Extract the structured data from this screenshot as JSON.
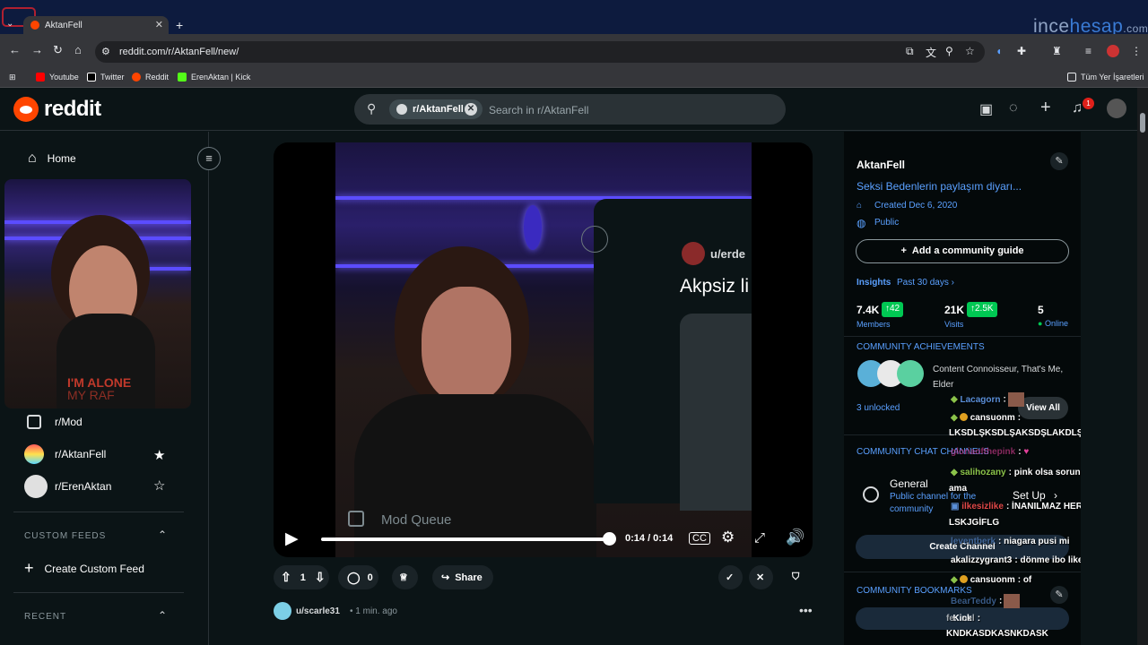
{
  "browser": {
    "tab_title": "AktanFell",
    "url": "reddit.com/r/AktanFell/new/",
    "bookmarks": [
      {
        "label": "Youtube",
        "color": "#ff0000"
      },
      {
        "label": "Twitter",
        "color": "#ffffff"
      },
      {
        "label": "Reddit",
        "color": "#ff4500"
      },
      {
        "label": "ErenAktan | Kick",
        "color": "#53fc18"
      }
    ],
    "bookmarks_folder": "Tüm Yer İşaretleri",
    "watermark_a": "ince",
    "watermark_b": "hesap",
    "watermark_c": ".com"
  },
  "header": {
    "brand": "reddit",
    "search_chip": "r/AktanFell",
    "search_placeholder": "Search in r/AktanFell",
    "notification_count": "1"
  },
  "left": {
    "home": "Home",
    "webcam_caption_1": "I'M ALONE",
    "webcam_caption_2": "MY RAF",
    "communities": [
      {
        "label": "r/Mod"
      },
      {
        "label": "r/AktanFell"
      },
      {
        "label": "r/ErenAktan"
      }
    ],
    "custom_feeds_heading": "CUSTOM FEEDS",
    "create_custom_feed": "Create Custom Feed",
    "recent_heading": "RECENT"
  },
  "video": {
    "overlay_user": "u/erde",
    "overlay_title": "Akpsiz li",
    "overlay_mod_queue": "Mod Queue",
    "time": "0:14 / 0:14",
    "progress": 1.0
  },
  "post": {
    "votes": "1",
    "comments": "0",
    "share": "Share",
    "author": "u/scarle31",
    "time": "• 1 min. ago"
  },
  "community": {
    "name": "AktanFell",
    "description": "Seksi Bedenlerin paylaşım diyarı...",
    "created": "Created Dec 6, 2020",
    "visibility": "Public",
    "add_guide": "Add a community guide",
    "insights": "Insights",
    "insights_range": "Past 30 days ›",
    "members_value": "7.4K",
    "members_delta": "42",
    "members_label": "Members",
    "visits_value": "21K",
    "visits_delta": "2.5K",
    "visits_label": "Visits",
    "online_value": "5",
    "online_label": "Online",
    "achievements_heading": "COMMUNITY ACHIEVEMENTS",
    "achievements_text": "Content Connoisseur, That's Me, Elder",
    "unlocked": "3 unlocked",
    "view_all": "View All",
    "chat_heading": "COMMUNITY CHAT CHANNELS",
    "channel_name": "General",
    "channel_desc_1": "Public channel for the",
    "channel_desc_2": "community",
    "setup": "Set Up",
    "create_channel": "Create Channel",
    "bookmarks_heading": "COMMUNITY BOOKMARKS",
    "bookmark_button": "Kick"
  },
  "chat_overlay": [
    {
      "user": "Lacagorn",
      "msg": ":",
      "color": "#5a8fd8"
    },
    {
      "user": "cansuonm",
      "msg": ":",
      "color": "#d7dadc"
    },
    {
      "user": "",
      "msg": "LKSDLŞKSDLŞAKSDŞLAKDLŞASKD",
      "color": "#ffffff"
    },
    {
      "user": "gloriaofthepink",
      "msg": ":",
      "color": "#e0409a"
    },
    {
      "user": "salihozany",
      "msg": ": pink olsa sorun olmazdı",
      "color": "#8bc34a"
    },
    {
      "user": "",
      "msg": "ama",
      "color": "#ffffff"
    },
    {
      "user": "ilkesizlike",
      "msg": ": İNANILMAZ HER ŞEY",
      "color": "#e04848"
    },
    {
      "user": "",
      "msg": "LSKJGİFLG",
      "color": "#ffffff"
    },
    {
      "user": "leventberk",
      "msg": ": niagara pusi mi",
      "color": "#5a8fd8"
    },
    {
      "user": "akalizzygrant3",
      "msg": ": dönme ibo liked it",
      "color": "#d7dadc"
    },
    {
      "user": "cansuonm",
      "msg": ": of",
      "color": "#d7dadc"
    },
    {
      "user": "BearTeddy",
      "msg": ":",
      "color": "#5a8fd8"
    },
    {
      "user": "fe...nel",
      "msg": ":",
      "color": "#d7dadc"
    },
    {
      "user": "",
      "msg": "KNDKASDKASNKDASK",
      "color": "#ffffff"
    }
  ]
}
